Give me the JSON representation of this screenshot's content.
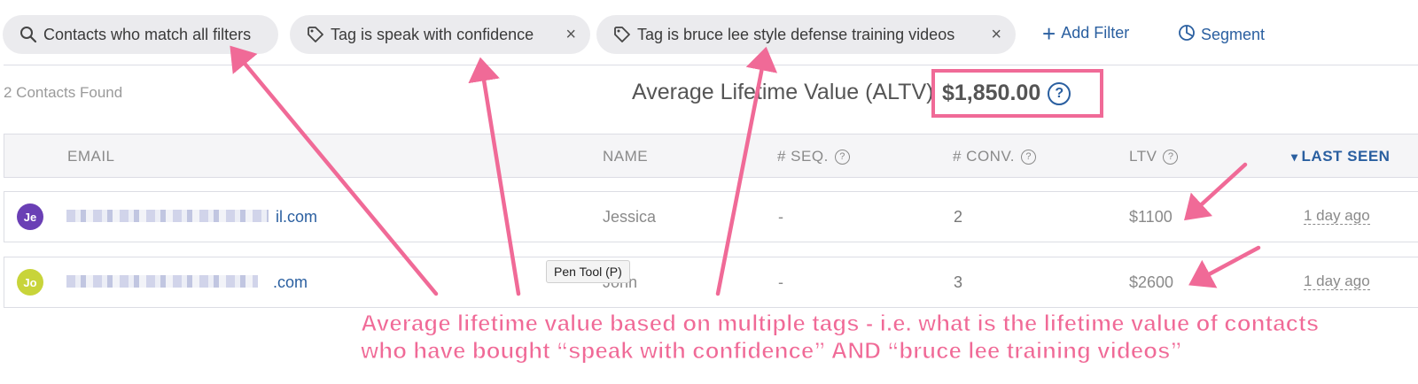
{
  "filters": [
    {
      "label": "Contacts who match all filters",
      "icon": "search-icon",
      "removable": false
    },
    {
      "label": "Tag is speak with confidence",
      "icon": "tag-icon",
      "removable": true,
      "remove": "×"
    },
    {
      "label": "Tag is bruce lee style defense training videos",
      "icon": "tag-icon",
      "removable": true,
      "remove": "×"
    }
  ],
  "actions": {
    "add_filter": "Add Filter",
    "add_filter_icon": "+",
    "segment": "Segment"
  },
  "summary": {
    "found": "2 Contacts Found",
    "altv_label": "Average Lifetime Value (ALTV)",
    "altv_value": "$1,850.00",
    "help": "?"
  },
  "columns": {
    "email": "EMAIL",
    "name": "NAME",
    "seq": "# SEQ.",
    "conv": "# CONV.",
    "ltv": "LTV",
    "last_seen": "LAST SEEN",
    "sort_indicator": "▾"
  },
  "rows": [
    {
      "initials": "Je",
      "avatar_color": "#6a3fb5",
      "email_suffix": "il.com",
      "name": "Jessica",
      "seq": "-",
      "conv": "2",
      "ltv": "$1100",
      "last_seen": "1 day ago"
    },
    {
      "initials": "Jo",
      "avatar_color": "#c8d43a",
      "email_suffix": ".com",
      "name": "John",
      "seq": "-",
      "conv": "3",
      "ltv": "$2600",
      "last_seen": "1 day ago"
    }
  ],
  "tooltip": "Pen Tool (P)",
  "annotation": {
    "line1": "Average lifetime value based on multiple tags - i.e. what is the lifetime value of contacts",
    "line2": "who have bought “speak with confidence” AND “bruce lee training videos”",
    "color": "#f06a97"
  },
  "colors": {
    "accent": "#2a5fa0",
    "chip_bg": "#ebebee",
    "annotation": "#f06a97"
  }
}
